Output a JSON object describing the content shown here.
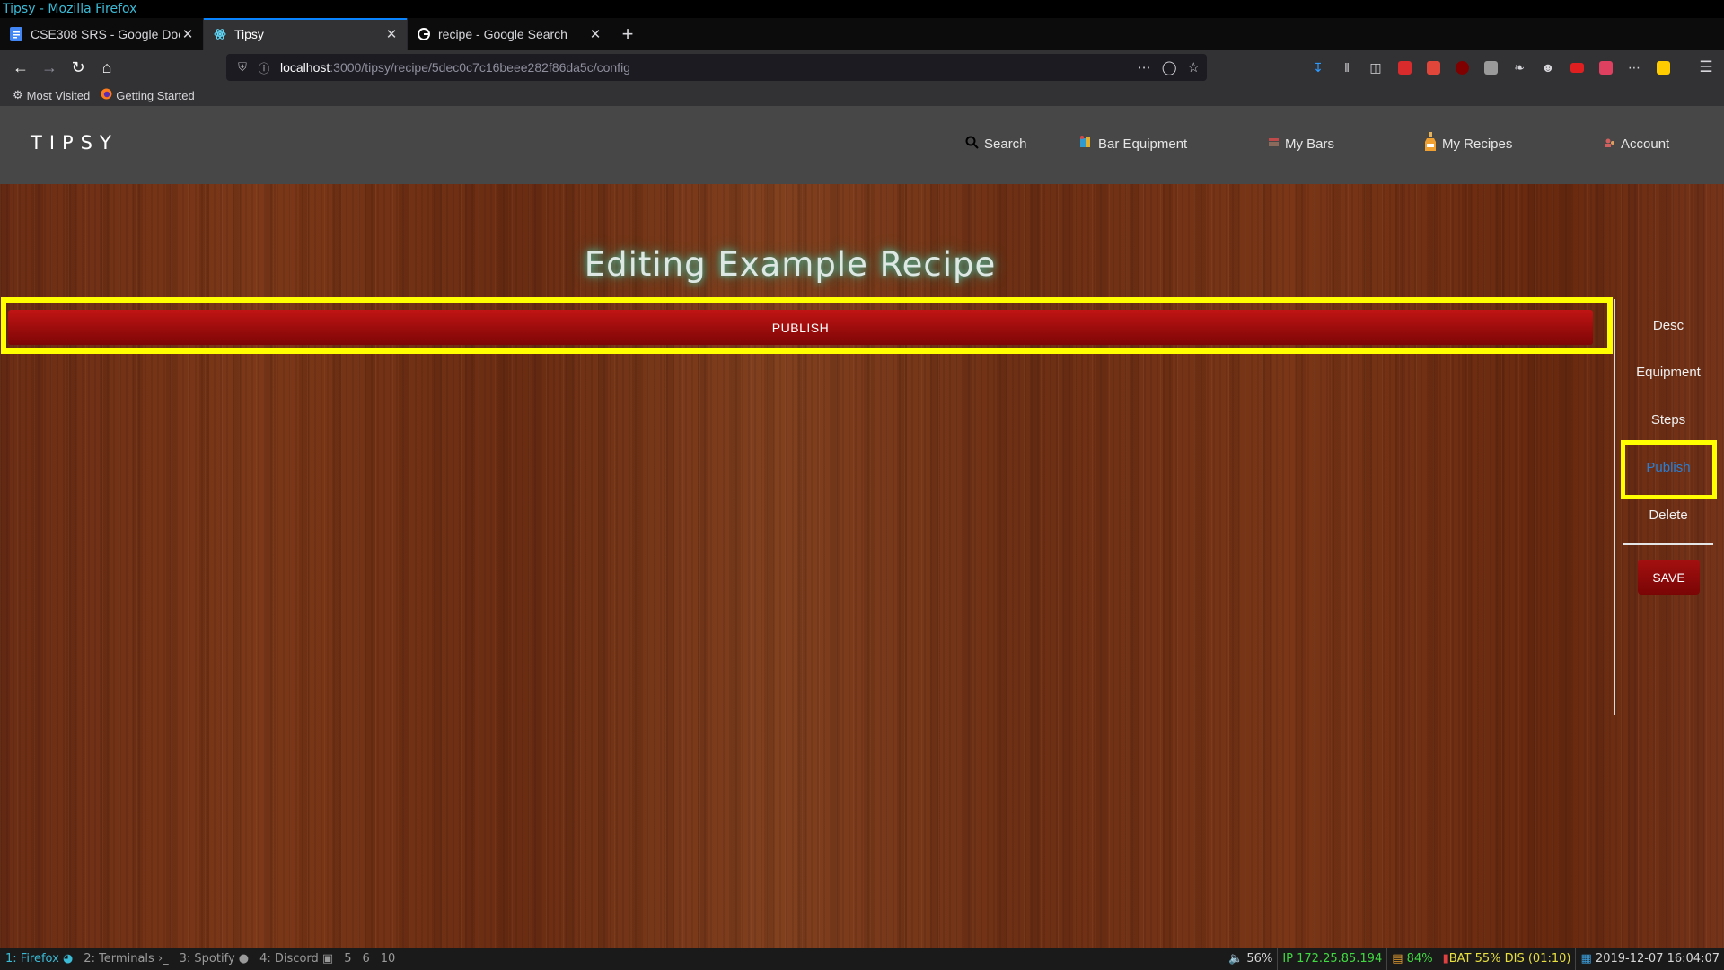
{
  "window_title": "Tipsy - Mozilla Firefox",
  "tabs": [
    {
      "title": "CSE308 SRS - Google Doc",
      "close": "✕"
    },
    {
      "title": "Tipsy",
      "close": "✕"
    },
    {
      "title": "recipe - Google Search",
      "close": "✕"
    }
  ],
  "new_tab": "+",
  "url": {
    "host": "localhost",
    "path": ":3000/tipsy/recipe/5dec0c7c16beee282f86da5c/config"
  },
  "bookmarks": [
    {
      "label": "Most Visited"
    },
    {
      "label": "Getting Started"
    }
  ],
  "site": {
    "logo": "TIPSY",
    "nav": [
      {
        "label": "Search"
      },
      {
        "label": "Bar Equipment"
      },
      {
        "label": "My Bars"
      },
      {
        "label": "My Recipes"
      },
      {
        "label": "Account"
      }
    ]
  },
  "page": {
    "heading": "Editing Example Recipe",
    "publish_bar_label": "PUBLISH",
    "side_items": [
      {
        "label": "Desc"
      },
      {
        "label": "Equipment"
      },
      {
        "label": "Steps"
      },
      {
        "label": "Publish"
      },
      {
        "label": "Delete"
      }
    ],
    "save_label": "SAVE"
  },
  "statusbar": {
    "workspaces": [
      {
        "label": "1: Firefox"
      },
      {
        "label": "2: Terminals"
      },
      {
        "label": "3: Spotify"
      },
      {
        "label": "4: Discord"
      },
      {
        "label": "5"
      },
      {
        "label": "6"
      },
      {
        "label": "10"
      }
    ],
    "volume": "56%",
    "ip": "IP 172.25.85.194",
    "wifi": "84%",
    "battery": "BAT 55% DIS (01:10)",
    "datetime": "2019-12-07 16:04:07"
  },
  "colors": {
    "highlight": "#ffff00",
    "publish_red": "#a50f0f",
    "active_link": "#2a7fd4",
    "site_nav": "#474747",
    "wood": "#6b2d14"
  }
}
